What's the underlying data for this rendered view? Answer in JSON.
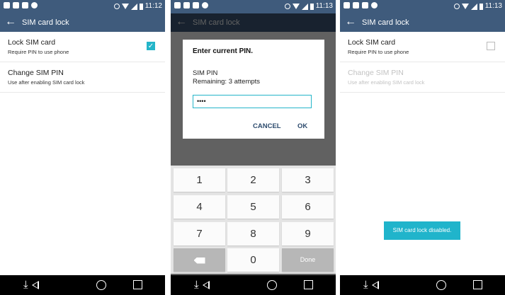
{
  "status_times": [
    "11:12",
    "11:13",
    "11:13"
  ],
  "app_title": "SIM card lock",
  "settings": {
    "lock_title": "Lock SIM card",
    "lock_sub": "Require PIN to use phone",
    "change_title": "Change SIM PIN",
    "change_sub": "Use after enabling SIM card lock"
  },
  "dialog": {
    "title": "Enter current PIN.",
    "label": "SIM PIN",
    "remaining": "Remaining: 3 attempts",
    "pin_value": "••••",
    "cancel": "CANCEL",
    "ok": "OK"
  },
  "keypad": {
    "keys": [
      "1",
      "2",
      "3",
      "4",
      "5",
      "6",
      "7",
      "8",
      "9",
      "0"
    ],
    "done": "Done"
  },
  "toast": "SIM card lock disabled.",
  "colors": {
    "bar": "#3f5b7c",
    "accent": "#24b5c9",
    "toast": "#20b4cb"
  },
  "states": {
    "panel1_checked": true,
    "panel3_checked": false
  }
}
